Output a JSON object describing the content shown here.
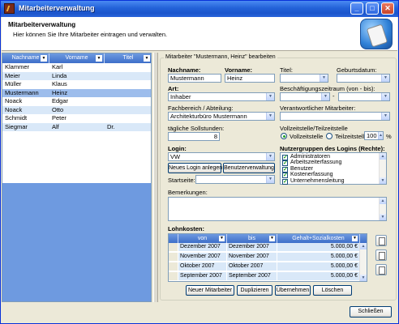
{
  "window": {
    "title": "Mitarbeiterverwaltung",
    "minimize": "_",
    "maximize": "□",
    "close": "✕"
  },
  "header": {
    "title": "Mitarbeiterverwaltung",
    "subtitle": "Hier können Sie Ihre Mitarbeiter eintragen und verwalten."
  },
  "list": {
    "columns": [
      "Nachname",
      "Vorname",
      "Titel"
    ],
    "rows": [
      {
        "nachname": "Klammer",
        "vorname": "Karl",
        "titel": ""
      },
      {
        "nachname": "Meier",
        "vorname": "Linda",
        "titel": ""
      },
      {
        "nachname": "Müller",
        "vorname": "Klaus",
        "titel": ""
      },
      {
        "nachname": "Mustermann",
        "vorname": "Heinz",
        "titel": ""
      },
      {
        "nachname": "Noack",
        "vorname": "Edgar",
        "titel": ""
      },
      {
        "nachname": "Noack",
        "vorname": "Otto",
        "titel": ""
      },
      {
        "nachname": "Schmidt",
        "vorname": "Peter",
        "titel": ""
      },
      {
        "nachname": "Siegmar",
        "vorname": "Alf",
        "titel": "Dr."
      }
    ],
    "selected_index": 3
  },
  "form": {
    "group_title": "Mitarbeiter \"Mustermann, Heinz\" bearbeiten",
    "nachname_label": "Nachname:",
    "nachname_value": "Mustermann",
    "vorname_label": "Vorname:",
    "vorname_value": "Heinz",
    "titel_label": "Titel:",
    "titel_value": "",
    "geburtsdatum_label": "Geburtsdatum:",
    "geburtsdatum_value": "",
    "art_label": "Art:",
    "art_value": "Inhaber",
    "beschaeftigung_label": "Beschäftigungszeitraum (von - bis):",
    "beschaeftigung_sep": "-",
    "fachbereich_label": "Fachbereich / Abteilung:",
    "fachbereich_value": "Architekturbüro Mustermann",
    "verantwortlich_label": "Verantwortlicher Mitarbeiter:",
    "sollstunden_label": "tägliche Sollstunden:",
    "sollstunden_value": "8",
    "vollzeit_group_label": "Vollzeitstelle/Teilzeitstelle",
    "vollzeit_label": "Vollzeitstelle",
    "teilzeit_label": "Teilzeitstelle",
    "teilzeit_percent": "100",
    "percent_sign": "%",
    "login_label": "Login:",
    "login_value": "VW",
    "neues_login_button": "Neues Login anlegen",
    "benutzerverwaltung_button": "Benutzerverwaltung",
    "startseite_label": "Startseite:",
    "startseite_value": "",
    "nutzergruppen_label": "Nutzergruppen des Logins (Rechte):",
    "nutzergruppen": [
      "Administratoren",
      "Arbeitszeiterfassung",
      "Benutzer",
      "Kostenerfassung",
      "Unternehmensleitung"
    ],
    "bemerkungen_label": "Bemerkungen:",
    "lohnkosten_label": "Lohnkosten:",
    "lohnkosten_columns": [
      "von",
      "bis",
      "Gehalt+Sozialkosten"
    ],
    "lohnkosten_rows": [
      {
        "von": "Dezember 2007",
        "bis": "Dezember 2007",
        "betrag": "5.000,00 €"
      },
      {
        "von": "November 2007",
        "bis": "November 2007",
        "betrag": "5.000,00 €"
      },
      {
        "von": "Oktober 2007",
        "bis": "Oktober 2007",
        "betrag": "5.000,00 €"
      },
      {
        "von": "September 2007",
        "bis": "September 2007",
        "betrag": "5.000,00 €"
      }
    ]
  },
  "buttons": {
    "neuer_mitarbeiter": "Neuer Mitarbeiter",
    "duplizieren": "Duplizieren",
    "uebernehmen": "Übernehmen",
    "loeschen": "Löschen",
    "schliessen": "Schließen"
  }
}
